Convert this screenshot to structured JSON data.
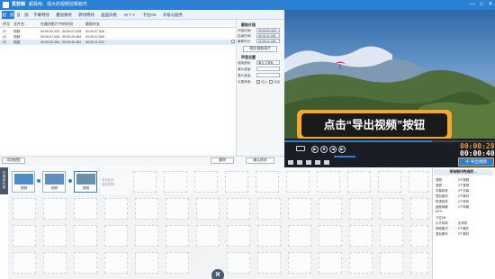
{
  "app": {
    "title": "爱剪辑",
    "subtitle": "超易用、强大的视频剪辑软件"
  },
  "window_buttons": [
    "—",
    "□",
    "✕"
  ],
  "tabs": [
    "视　频",
    "音　频",
    "字幕特效",
    "叠加素材",
    "转场特效",
    "画面风格",
    "M T V",
    "卡拉OK",
    "升级与服务"
  ],
  "table": {
    "headers": [
      "序号",
      "文件名",
      "在最终影片中的时间",
      "截取时长"
    ],
    "rows": [
      {
        "num": "01",
        "name": "视频",
        "time": "00:00:00.000 - 00:00:07.945",
        "dur": "00:00:07.945"
      },
      {
        "num": "02",
        "name": "视频",
        "time": "00:00:07.945 - 00:00:29.454",
        "dur": "00:00:21.509"
      },
      {
        "num": "03",
        "name": "视频",
        "time": "00:00:29.454 - 00:00:40.454",
        "dur": "00:00:11.000"
      }
    ]
  },
  "clip_panel": {
    "title": "截取片段",
    "start_label": "开始时间:",
    "start_value": "00:00:00.000",
    "end_label": "结束时间:",
    "end_value": "00:00:11.000",
    "dur_label": "截取时长:",
    "dur_value": "00:00:11.000",
    "preview_btn": "预览/截取原片",
    "audio_title": "声音设置",
    "track_label": "使用音轨:",
    "track_value": "原片主音轨",
    "speed_label": "原片音量:",
    "speed_value": "",
    "vol_label": "原片音量:",
    "vol_value": "",
    "fade_label": "头尾声音:",
    "fade_in": "淡入",
    "fade_out": "淡出",
    "confirm": "确认修改"
  },
  "left_footer": {
    "add": "添加视频",
    "delete": "删除"
  },
  "callout": "点击“导出视频”按钮",
  "player": {
    "time_current": "00:00:28.480",
    "time_total": "00:00:40.454",
    "export": "导出视频"
  },
  "timeline": {
    "side_label": "已添加片段",
    "clips": [
      "视频",
      "视频",
      "视频"
    ],
    "tail_text": "双击此处\n添加视频"
  },
  "info_panel": {
    "title": "所有制作完成的 ...",
    "items": [
      {
        "k": "视频:",
        "v": "3个视频"
      },
      {
        "k": "音频:",
        "v": "0个音频"
      },
      {
        "k": "字幕特效:",
        "v": "0个字幕"
      },
      {
        "k": "叠加素材:",
        "v": "0个素材"
      },
      {
        "k": "转场特效:",
        "v": "0个特效"
      },
      {
        "k": "画面风格:",
        "v": "0个风格"
      },
      {
        "k": "MTV:",
        "v": ""
      },
      {
        "k": "卡拉OK:",
        "v": ""
      },
      {
        "k": "片头特效:",
        "v": "无特效"
      },
      {
        "k": "视频格式:",
        "v": "0个格式"
      },
      {
        "k": "叠加素材:",
        "v": "0个素材"
      }
    ]
  },
  "colors": {
    "accent": "#2a80d3",
    "highlight": "#f4a92c",
    "timecode_orange": "#f59a23",
    "timecode_white": "#ffffff"
  }
}
